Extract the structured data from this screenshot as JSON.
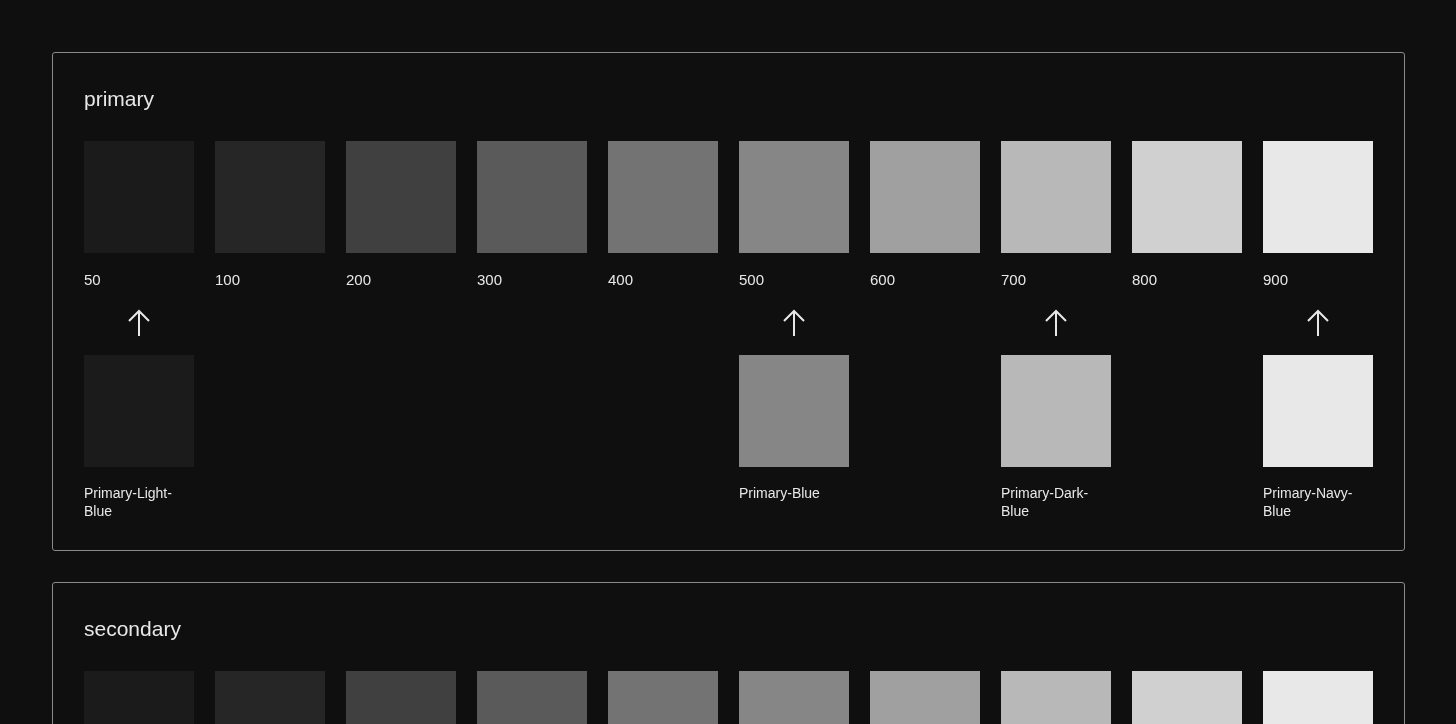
{
  "palettes": [
    {
      "title": "primary",
      "swatches": [
        {
          "label": "50",
          "color": "#1b1b1b",
          "alias": {
            "name": "Primary-Light-Blue",
            "color": "#1b1b1b"
          }
        },
        {
          "label": "100",
          "color": "#262626"
        },
        {
          "label": "200",
          "color": "#404040"
        },
        {
          "label": "300",
          "color": "#5a5a5a"
        },
        {
          "label": "400",
          "color": "#737373"
        },
        {
          "label": "500",
          "color": "#868686",
          "alias": {
            "name": "Primary-Blue",
            "color": "#868686"
          }
        },
        {
          "label": "600",
          "color": "#a0a0a0"
        },
        {
          "label": "700",
          "color": "#b8b8b8",
          "alias": {
            "name": "Primary-Dark-Blue",
            "color": "#b8b8b8"
          }
        },
        {
          "label": "800",
          "color": "#d0d0d0"
        },
        {
          "label": "900",
          "color": "#e8e8e8",
          "alias": {
            "name": "Primary-Navy-Blue",
            "color": "#e8e8e8"
          }
        }
      ]
    },
    {
      "title": "secondary",
      "swatches": [
        {
          "color": "#1b1b1b"
        },
        {
          "color": "#262626"
        },
        {
          "color": "#404040"
        },
        {
          "color": "#5a5a5a"
        },
        {
          "color": "#737373"
        },
        {
          "color": "#868686"
        },
        {
          "color": "#a0a0a0"
        },
        {
          "color": "#b8b8b8"
        },
        {
          "color": "#d0d0d0"
        },
        {
          "color": "#e8e8e8"
        }
      ]
    }
  ]
}
